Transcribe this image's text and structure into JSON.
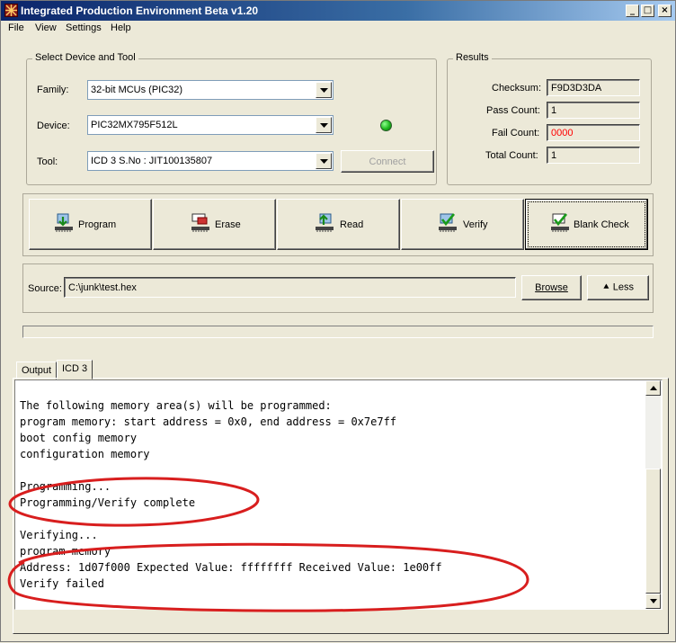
{
  "window": {
    "title": "Integrated Production Environment Beta v1.20",
    "controls": [
      "_",
      "□",
      "×"
    ]
  },
  "menu": [
    "File",
    "View",
    "Settings",
    "Help"
  ],
  "device_group": {
    "legend": "Select Device and Tool",
    "family_label": "Family:",
    "family_value": "32-bit MCUs (PIC32)",
    "device_label": "Device:",
    "device_value": "PIC32MX795F512L",
    "tool_label": "Tool:",
    "tool_value": "ICD 3 S.No : JIT100135807",
    "connect_label": "Connect",
    "status_color": "#1fb81f"
  },
  "results": {
    "legend": "Results",
    "checksum_label": "Checksum:",
    "checksum_value": "F9D3D3DA",
    "pass_label": "Pass Count:",
    "pass_value": "1",
    "fail_label": "Fail Count:",
    "fail_value": "0000",
    "fail_color": "#ff0000",
    "total_label": "Total Count:",
    "total_value": "1"
  },
  "actions": {
    "program": "Program",
    "erase": "Erase",
    "read": "Read",
    "verify": "Verify",
    "blank_check": "Blank Check"
  },
  "source": {
    "label": "Source:",
    "path": "C:\\junk\\test.hex",
    "browse": "Browse",
    "less": "⯅ Less"
  },
  "tabs": {
    "output": "Output",
    "icd3": "ICD 3"
  },
  "console": {
    "lines": [
      "The following memory area(s) will be programmed:",
      "program memory: start address = 0x0, end address = 0x7e7ff",
      "boot config memory",
      "configuration memory",
      "",
      "Programming...",
      "Programming/Verify complete",
      "",
      "Verifying...",
      "program memory",
      "Address: 1d07f000 Expected Value: ffffffff Received Value: 1e00ff",
      "Verify failed"
    ]
  },
  "annotation_color": "#d81e1e"
}
